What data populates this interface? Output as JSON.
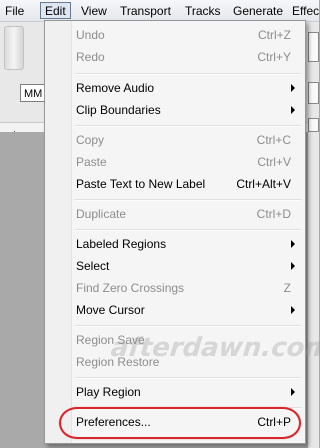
{
  "menubar": {
    "items": [
      {
        "label": "File",
        "active": false
      },
      {
        "label": "Edit",
        "active": true
      },
      {
        "label": "View",
        "active": false
      },
      {
        "label": "Transport",
        "active": false
      },
      {
        "label": "Tracks",
        "active": false
      },
      {
        "label": "Generate",
        "active": false
      },
      {
        "label": "Effec",
        "active": false
      }
    ]
  },
  "toolbar": {
    "selector_value": "MM"
  },
  "edit_menu": {
    "items": [
      {
        "label": "Undo",
        "shortcut": "Ctrl+Z",
        "disabled": true
      },
      {
        "label": "Redo",
        "shortcut": "Ctrl+Y",
        "disabled": true
      },
      {
        "label": "Remove Audio",
        "submenu": true
      },
      {
        "label": "Clip Boundaries",
        "submenu": true
      },
      {
        "label": "Copy",
        "shortcut": "Ctrl+C",
        "disabled": true
      },
      {
        "label": "Paste",
        "shortcut": "Ctrl+V",
        "disabled": true
      },
      {
        "label": "Paste Text to New Label",
        "shortcut": "Ctrl+Alt+V",
        "disabled": false
      },
      {
        "label": "Duplicate",
        "shortcut": "Ctrl+D",
        "disabled": true
      },
      {
        "label": "Labeled Regions",
        "submenu": true
      },
      {
        "label": "Select",
        "submenu": true
      },
      {
        "label": "Find Zero Crossings",
        "shortcut": "Z",
        "disabled": true
      },
      {
        "label": "Move Cursor",
        "submenu": true
      },
      {
        "label": "Region Save",
        "disabled": true
      },
      {
        "label": "Region Restore",
        "disabled": true
      },
      {
        "label": "Play Region",
        "submenu": true
      },
      {
        "label": "Preferences...",
        "shortcut": "Ctrl+P",
        "disabled": false,
        "highlighted": true
      }
    ]
  },
  "watermark": "afterdawn.com",
  "colors": {
    "highlight_oval": "#d9262b",
    "menu_background": "#f5f5f5",
    "disabled_text": "#8d8d8d"
  }
}
